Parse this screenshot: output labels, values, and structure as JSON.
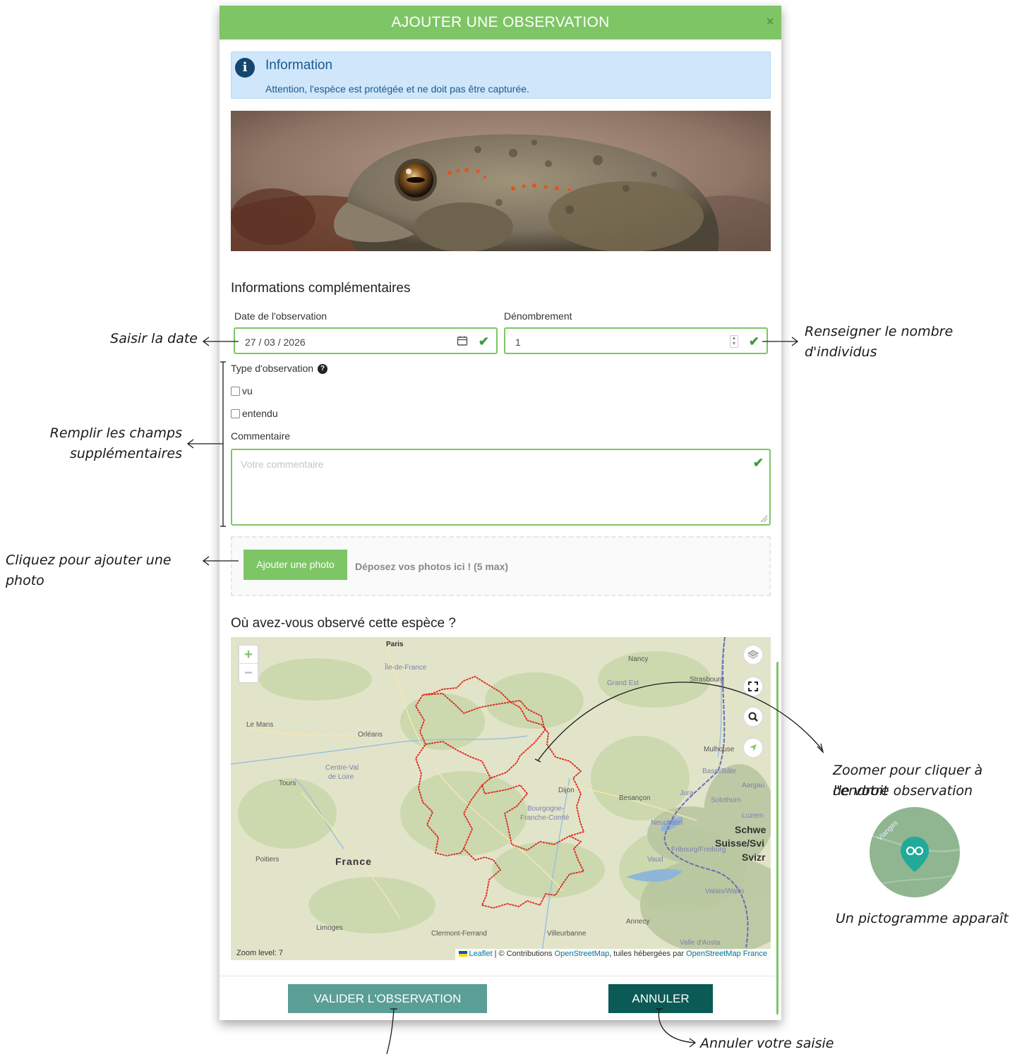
{
  "modal": {
    "title": "AJOUTER UNE OBSERVATION",
    "close_label": "×",
    "info": {
      "title": "Information",
      "text": "Attention, l'espèce est protégée et ne doit pas être capturée."
    },
    "section_title": "Informations complémentaires",
    "date": {
      "label": "Date de l'observation",
      "value": "27 / 03 / 2026"
    },
    "count": {
      "label": "Dénombrement",
      "value": "1"
    },
    "observation_type": {
      "label": "Type d'observation",
      "options": [
        {
          "label": "vu",
          "checked": false
        },
        {
          "label": "entendu",
          "checked": false
        }
      ]
    },
    "comment": {
      "label": "Commentaire",
      "placeholder": "Votre commentaire"
    },
    "photo_upload": {
      "button_label": "Ajouter une photo",
      "drop_text": "Déposez vos photos ici ! (5 max)"
    },
    "map_section_title": "Où avez-vous observé cette espèce ?",
    "map": {
      "zoom_in": "+",
      "zoom_out": "−",
      "zoom_level_text": "Zoom level: 7",
      "attribution": {
        "leaflet": "Leaflet",
        "text1": " | © Contributions ",
        "osm": "OpenStreetMap",
        "text2": ", tuiles hébergées par ",
        "osm_france": "OpenStreetMap France"
      },
      "place_labels": {
        "paris": "Paris",
        "ile_de_france": "Île-de-France",
        "nancy": "Nancy",
        "grand_est": "Grand Est",
        "strasbourg": "Strasbourg",
        "le_mans": "Le Mans",
        "orleans": "Orléans",
        "centre_val_de_loire_1": "Centre-Val",
        "centre_val_de_loire_2": "de Loire",
        "tours": "Tours",
        "mulhouse": "Mulhouse",
        "basel": "Basel/Bâle",
        "dijon": "Dijon",
        "besancon": "Besançon",
        "bourgogne_1": "Bourgogne-",
        "bourgogne_2": "Franche-Comté",
        "neuchatel": "Neuchâtel",
        "schweiz_1": "Schwe",
        "schweiz_2": "Suisse/Svi",
        "schweiz_3": "Svizr",
        "fribourg": "Fribourg/Freiburg",
        "poitiers": "Poitiers",
        "france": "France",
        "limoges": "Limoges",
        "clermont": "Clermont-Ferrand",
        "villeurbanne": "Villeurbanne",
        "annecy": "Annecy",
        "valais": "Valais/Wallis",
        "valle_aosta": "Valle d'Aosta",
        "luzern": "Luzern",
        "solothurn": "Solothurn",
        "aargau": "Aargau",
        "jura": "Jura",
        "vaud": "Vaud"
      }
    },
    "buttons": {
      "validate": "VALIDER L'OBSERVATION",
      "cancel": "ANNULER"
    }
  },
  "annotations": {
    "date": "Saisir la date",
    "count_1": "Renseigner le nombre",
    "count_2": "d'individus",
    "extra_1": "Remplir les champs",
    "extra_2": "supplémentaires",
    "photo": "Cliquez pour ajouter une photo",
    "zoom_1": "Zoomer pour cliquer à l'endroit",
    "zoom_2": "de votre observation",
    "pictogram": "Un pictogramme apparaît",
    "pictogram_place": "Vianges",
    "cancel": "Annuler votre saisie"
  },
  "colors": {
    "header_green": "#7ec566",
    "info_bg": "#cfe6fb",
    "validate_btn": "#5a9e96",
    "cancel_btn": "#0b5a55",
    "region_border": "#e0241b",
    "marker": "#21a99a"
  },
  "icons": {
    "info": "info-circle-icon",
    "calendar": "calendar-icon",
    "check": "check-icon",
    "help": "question-circle-icon",
    "layers": "layers-icon",
    "fullscreen": "fullscreen-icon",
    "search": "search-icon",
    "locate": "locate-arrow-icon",
    "marker": "binoculars-marker-icon"
  }
}
